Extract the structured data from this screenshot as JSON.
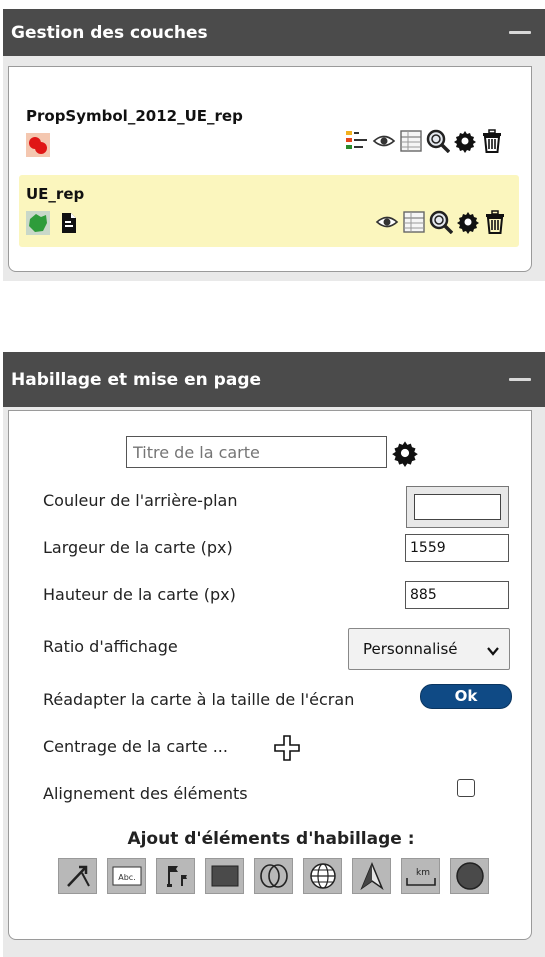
{
  "layers_panel": {
    "title": "Gestion des couches",
    "layers": [
      {
        "name": "PropSymbol_2012_UE_rep"
      },
      {
        "name": "UE_rep"
      }
    ]
  },
  "layout_panel": {
    "title": "Habillage et mise en page",
    "map_title_placeholder": "Titre de la carte",
    "background_color_label": "Couleur de l'arrière-plan",
    "background_color": "#ffffff",
    "width_label": "Largeur de la carte (px)",
    "width_value": "1559",
    "height_label": "Hauteur de la carte (px)",
    "height_value": "885",
    "ratio_label": "Ratio d'affichage",
    "ratio_value": "Personnalisé",
    "fit_label": "Réadapter la carte à la taille de l'écran",
    "fit_button": "Ok",
    "center_label": "Centrage de la carte ...",
    "alignment_label": "Alignement des éléments",
    "elements_title": "Ajout d'éléments d'habillage :",
    "element_icons": [
      "arrow-line-icon",
      "text-label-icon",
      "flags-icon",
      "rectangle-icon",
      "ellipse-icon",
      "graticule-icon",
      "north-arrow-icon",
      "scale-bar-icon",
      "circle-icon"
    ],
    "scale_unit": "km",
    "text_sample": "Abc."
  },
  "colors": {
    "header_bg": "#4b4b4b",
    "highlight": "#fbf6be",
    "ok_button": "#0f4a85"
  }
}
